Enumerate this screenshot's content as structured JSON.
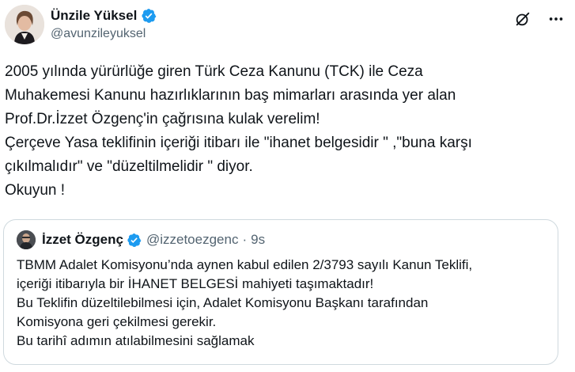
{
  "author": {
    "display_name": "Ünzile Yüksel",
    "handle": "@avunzileyuksel",
    "verified_icon": "verified-badge-icon",
    "avatar_icon": "profile-photo"
  },
  "actions": {
    "grok_icon": "grok-icon",
    "more_icon": "more-options-icon"
  },
  "tweet": {
    "lines": [
      "2005 yılında yürürlüğe giren Türk Ceza Kanunu (TCK) ile Ceza",
      "Muhakemesi Kanunu hazırlıklarının baş mimarları arasında yer alan",
      "Prof.Dr.İzzet Özgenç'in çağrısına kulak verelim!",
      "Çerçeve Yasa teklifinin içeriği itibarı ile \"ihanet belgesidir \" ,\"buna karşı",
      "çıkılmalıdır\" ve \"düzeltilmelidir \" diyor.",
      "Okuyun !"
    ]
  },
  "quote": {
    "display_name": "İzzet Özgenç",
    "handle": "@izzetoezgenc",
    "separator": "·",
    "time": "9s",
    "lines": [
      "TBMM Adalet Komisyonu’nda aynen kabul edilen 2/3793 sayılı Kanun Teklifi,",
      "içeriği itibarıyla bir İHANET BELGESİ mahiyeti taşımaktadır!",
      "Bu Teklifin düzeltilebilmesi için, Adalet Komisyonu Başkanı tarafından",
      "Komisyona geri çekilmesi gerekir.",
      "Bu tarihî adımın atılabilmesini sağlamak"
    ]
  },
  "colors": {
    "text": "#0f1419",
    "secondary": "#536471",
    "verified": "#1d9bf0",
    "border": "#cfd9de"
  }
}
